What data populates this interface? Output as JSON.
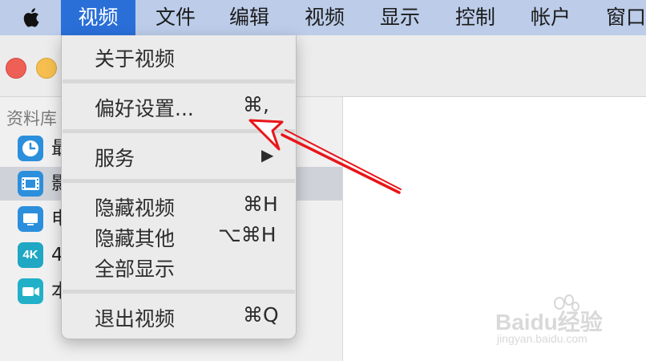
{
  "menubar": {
    "apple_icon": "apple-logo",
    "items": [
      "视频",
      "文件",
      "编辑",
      "视频",
      "显示",
      "控制",
      "帐户",
      "窗口"
    ]
  },
  "sidebar": {
    "header": "资料库",
    "items": [
      {
        "label": "最",
        "icon": "clock-icon",
        "color": "#2b8fdc"
      },
      {
        "label": "影",
        "icon": "film-icon",
        "color": "#2b8fdc"
      },
      {
        "label": "电",
        "icon": "tv-icon",
        "color": "#2b8fdc"
      },
      {
        "label": "4",
        "icon": "4k-icon",
        "icon_text": "4K",
        "color": "#1fa7c4"
      },
      {
        "label": "本",
        "icon": "video-camera-icon",
        "color": "#22b0c8"
      }
    ]
  },
  "menu": {
    "about": "关于视频",
    "preferences": "偏好设置...",
    "preferences_shortcut": "⌘,",
    "services": "服务",
    "services_submenu": "▶",
    "hide": "隐藏视频",
    "hide_shortcut": "⌘H",
    "hide_others": "隐藏其他",
    "hide_others_shortcut": "⌥⌘H",
    "show_all": "全部显示",
    "quit": "退出视频",
    "quit_shortcut": "⌘Q"
  },
  "annotation": {
    "arrow_color": "#e8161a"
  },
  "watermark": {
    "text": "Baidu经验",
    "url_text": "jingyan.baidu.com"
  }
}
